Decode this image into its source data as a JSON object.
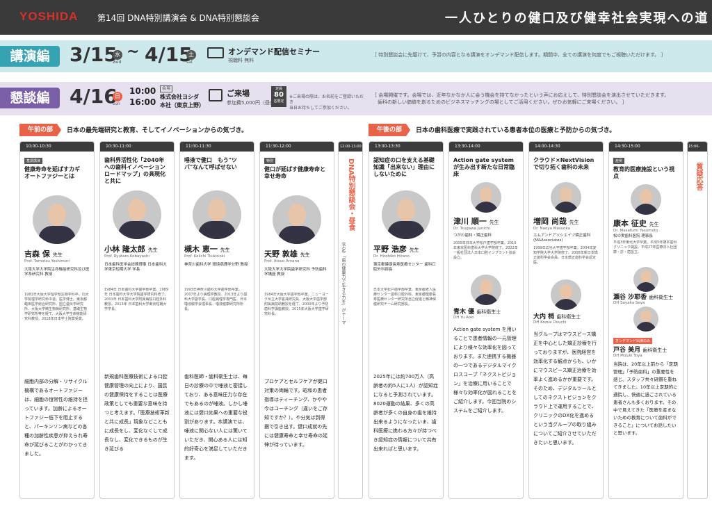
{
  "header": {
    "logo": "YOSHIDA",
    "title": "第14回 DNA特別講演会 & DNA特別懇談会",
    "slogan": "一人ひとりの健口及び健幸社会実現への道"
  },
  "lecture": {
    "tag": "講演編",
    "start_date": "3/15",
    "start_dow": "水",
    "start_dow_en": "wed",
    "tilde": "~",
    "end_date": "4/15",
    "end_dow": "土",
    "end_dow_en": "sat",
    "seminar": "オンデマンド配信セミナー",
    "seminar_sub": "視聴料 無料",
    "notice": "［ 特別懇談会に先駆けて、予習の内容となる講演をオンデマンド配信します。期間中、全ての講演を何度でもご視聴いただけます。 ］"
  },
  "talk": {
    "tag": "懇談編",
    "date": "4/16",
    "dow": "日",
    "dow_en": "sun",
    "time_start": "10:00",
    "time_end": "16:00",
    "venue_label": "会場",
    "venue": "株式会社ヨシダ",
    "venue2": "本社（東京上野）",
    "visit": "ご来場",
    "fee": "参加費5,000円（昼食）",
    "cap_label": "定員",
    "cap_num": "80",
    "cap_unit": "名限定",
    "cap_note1": "※ご来場の際は、お名前をご登録いただき",
    "cap_note2": "当日お持ちしてご参加ください。",
    "notice1": "［ 会場開催です。会場では、近年なかなか人に会う機会を持てなかったという声にお応えして、特別懇談会を演出させていただきます。",
    "notice2": "歯科の新しい価値を創るためのビジネスマッチングの場としてご活用ください。ぜひお気軽にご来場ください。 ］"
  },
  "morning": {
    "label": "午前の部",
    "heading": "日本の最先端研究と教育、そしてイノベーションからの気づき。"
  },
  "afternoon": {
    "label": "午後の部",
    "heading": "日本の歯科医療で実践されている患者本位の医療と予防からの気づき。"
  },
  "lunch": {
    "time": "12:00-13:00",
    "title": "DNA特別懇談会・昼食",
    "note": "（予定）「歯の健康力で生きる力を」がテーマ"
  },
  "qa": {
    "time": "15:00-15:30",
    "title": "質疑応答"
  },
  "speakers": [
    {
      "time": "10:00-10:30",
      "title": "健康寿命を延ばすカギ　オートファジーとは",
      "badge": "基調講演",
      "name": "吉森 保",
      "suffix": "先生",
      "roman": "Prof. Tamotsu Yoshimori",
      "aff": "大阪大学大学院生命機能研究科及び医学系研究科 教授",
      "bio": "1981年大阪大学理学部生物学科卒。同大学院理学研究科中退。医学博士。東京都臨床医学総合研究所、国立遺伝学研究所、大阪大学微生物病研究所、基礎生物学研究所等を経て、大阪大学生命機能研究科教授。2018年日本学士院賞受賞。",
      "desc": "細胞内部の分解・リサイクル機構であるオートファジーは、細胞の恒常性の維持を担っています。加齢によるオートファジー低下を阻止すると、パーキンソン病などの各種の加齢性疾患が抑えられ寿命が延びることがわかってきました。"
    },
    {
      "time": "10:30-11:00",
      "title": "歯科界活性化「2040年への歯科イノベーションロードマップ」の具現化と共に",
      "badge": "",
      "name": "小林 隆太郎",
      "suffix": "先生",
      "roman": "Prof. Ryutaro Kobayashi",
      "aff": "日本歯科医学会総務理事 日本歯科大学東京短期大学 学長",
      "bio": "1984年 日本歯科大学歯学部卒業。1989年 日本歯科大学大学院歯学研究科修了。2001年 日本歯科大学附属病院口腔外科教授。2013年 日本歯科大学東京短期大学学長。",
      "desc": "新規歯科医療技術による口腔健康管理の向上により、国民の健康保持をすることは医療政策としても重要な意味を持つと考えます。「医療技術革新と共に成長」現象などこともに成長をし、変化なくして成長なし、変化できるものが生き延びる"
    },
    {
      "time": "11:00-11:30",
      "title": "唾液で健口　もう\"ツバ\"なんて呼ばせない",
      "badge": "",
      "name": "槻木 恵一",
      "suffix": "先生",
      "roman": "Prof. Keiichi Tsukinoki",
      "aff": "神奈川歯科大学 環境病理学分野 教授",
      "bio": "1993年神奈川歯科大学歯学部卒業。2007年より病理学教授。2013年より歯科大学副学長。口腔病理学専門医、日本唾液腺学会理事長、唾液健康研究所所長。",
      "desc": "歯科医師・歯科衛生士は、毎日の診療の中で唾液と密接しており、ある意味圧力な存在でもあるのが唾液。しかし唾液には健口効果への重要な役割があります。本講演では、唾液に関心ない人には驚いていただき、関心ある人には知的好奇心を満足していただきます。"
    },
    {
      "time": "11:30-12:00",
      "title": "健口が延ばす健康寿命と幸せ寿命",
      "badge": "特別",
      "name": "天野 敦雄",
      "suffix": "先生",
      "roman": "Prof. Atsuo Amano",
      "aff": "大阪大学大学院歯学研究科 予防歯科学講座 教授",
      "bio": "1984年大阪大学歯学部卒業。ニューヨーク州立大学客員研究員、大阪大学歯学部附属病院助教授を経て、2000年より予防歯科学講座教授。2015年大阪大学歯学研究科長。",
      "desc": "プロケアとセルフケアが健口対策の両輪です。昭和の患者指導はティーチング、かやや今はコーチング（違いをご存知ですか？）。や分気は到得据で引き出す。健口成就の先には健康寿命と幸せ寿命の延伸が待っています。"
    },
    {
      "time": "13:00-13:30",
      "title": "認知症の口を支える基礎知識「出来ない」理由にしないために",
      "badge": "",
      "name": "平野 浩彦",
      "suffix": "先生",
      "roman": "Dr. Hirohiko Hirano",
      "aff": "東京都健康長寿医療センター 歯科口腔外科部長",
      "bio": "日本大学松戸歯学部卒業。東京都老人医療センター歯科口腔外科、東京都健康長寿医療センター研究所自立促進と精神保健研究チーム研究部長。",
      "desc": "2025年には約700万人（高齢者の約5人に1人）が認知症になると予測されています。8020運動の結果、多くの高齢者が多くの自身の歯を維持出来るようになったいま、歯科医療に携わる方々が持つべき認知症の情報について共有出来ればと思います。"
    },
    {
      "time": "13:30-14:00",
      "title": "Action gate system が生み出す新たな日常臨床",
      "badge": "",
      "name": "津川 順一",
      "suffix": "先生",
      "roman": "Dr. Tsugawa Junichi",
      "aff": "つがわ歯科・矯正歯科",
      "bio": "2005年日本大学松戸歯学部卒業。2010年東京医科歯科大学大学院修了。2022年一般社団法人日本口腔インプラント協会設立。",
      "desc": "Action gate system を用いることで患者情報の一元管理により様々な効率化を図っております。また連携する機器の一つであるデジタルマイクロスコープ「ネクストビジョン」を治療に用いることで様々な効率化が図れることをご紹介します。今回当院のシステムをご紹介します。"
    },
    {
      "time": "14:00-14:30",
      "title": "クラウド×NextVisionで切り拓く歯科の未来",
      "badge": "",
      "name": "増岡 尚哉",
      "suffix": "先生",
      "roman": "Dr. Naoya Masuoka",
      "aff": "エムアンドアソシエイツ矯正歯科 (M&Associates)",
      "bio": "1999年広島大学歯学部卒業。2004年愛知学院大学大学院修了。2008年新日本矯正歯科学会会員。日本矯正歯科学会認定医。",
      "desc": "当グループはマウスピース矯正を中心とした矯正診療を行っておりますが、医院経営を効率化する観点からも、いかにマウスピース矯正治療を効率よく進めるかが重要です。そのため、デジタルツールとしてのネクストビジョンをクラウド上で運用することで、クリニックのDX化を進めるという当グループの取り組みについてご紹介させていただきたいと思います。"
    },
    {
      "time": "14:30-15:00",
      "title": "教育的医療施設という視点",
      "badge": "症例",
      "name": "康本 征史",
      "suffix": "先生",
      "roman": "Dr. Masafumi Yasumoto",
      "aff": "松の実歯科医院 理事長",
      "bio": "平成3年東北大学卒業。平成5年康本歯科クリニック開設。平成27年医療法人社団 康・診・歯設立。",
      "desc": "当院は、20年以上前から「定期管理」「予防歯科」の重要性を感じ、スタッフ共々研鑽を重ねてきました。10年以上定期的に通院し、快適に過ごされている患者さんも多くおります。その中で見えてきた「医療を産まないための教育について歯科ができること」についてお話したいと思います。"
    }
  ],
  "sub_speakers": [
    {
      "name": "青木 優",
      "suffix": "歯科衛生士",
      "roman": "DH Yu Aoki"
    },
    {
      "name": "大内 梢",
      "suffix": "歯科衛生士",
      "roman": "DH Kozue Oouchi"
    },
    {
      "name": "瀬谷 沙耶香",
      "suffix": "歯科衛生士",
      "roman": "DH Sayaka Seya"
    },
    {
      "name": "戸谷 美月",
      "suffix": "歯科衛生士",
      "roman": "DH Mizuki Toya",
      "badge": "オンデマンド出演のみ"
    }
  ],
  "colors": {
    "accent": "#e8624a",
    "lecture_bg": "#cde9ec",
    "talk_bg": "#e6e0ef",
    "lecture_tag": "#35a3b1",
    "talk_tag": "#7b5ea8"
  }
}
